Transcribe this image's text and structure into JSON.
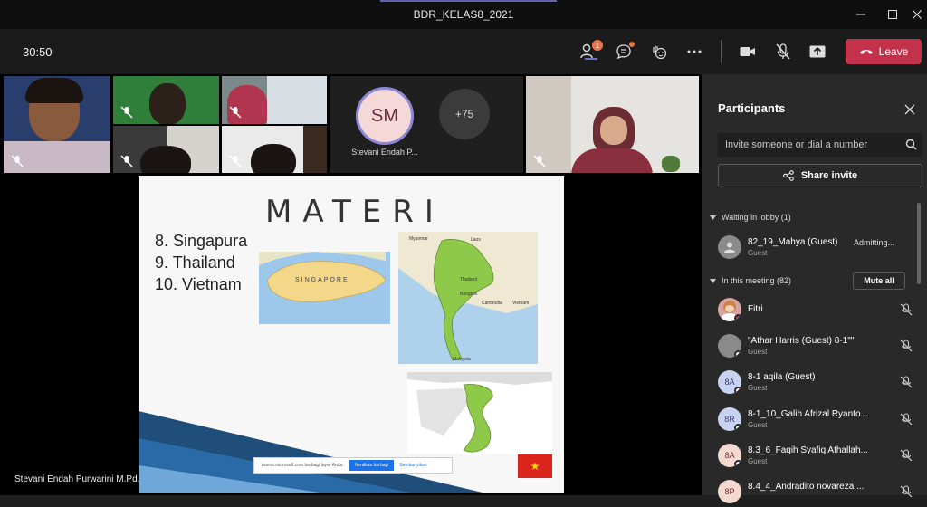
{
  "window": {
    "title": "BDR_KELAS8_2021"
  },
  "toolbar": {
    "timer": "30:50",
    "participants_badge": "1",
    "leave_label": "Leave"
  },
  "gallery": {
    "sm_initials": "SM",
    "sm_name": "Stevani Endah P...",
    "overflow_count": "+75"
  },
  "slide": {
    "title": "MATERI",
    "items": [
      "8. Singapura",
      "9. Thailand",
      "10. Vietnam"
    ],
    "map_label_singapore": "SINGAPORE",
    "map_labels_thailand": [
      "Myanmar",
      "Laos",
      "Thailand",
      "Cambodia",
      "Vietnam",
      "Bangkok",
      "Malaysia"
    ],
    "sharebar_text": "teams.microsoft.com berbagi layar Anda.",
    "sharebar_stop": "Hentikan berbagi",
    "sharebar_hide": "Sembunyikan"
  },
  "presenter_name": "Stevani Endah Purwarini M.Pd.",
  "panel": {
    "title": "Participants",
    "search_placeholder": "Invite someone or dial a number",
    "share_invite": "Share invite",
    "lobby_label": "Waiting in lobby (1)",
    "meeting_label": "In this meeting (82)",
    "mute_all": "Mute all",
    "lobby": [
      {
        "name": "82_19_Mahya (Guest)",
        "sub": "Guest",
        "status": "Admitting..."
      }
    ],
    "members": [
      {
        "name": "Fitri",
        "sub": "",
        "initials": "",
        "color": "#d9a3a3"
      },
      {
        "name": "\"Athar Harris (Guest) 8-1\"\"",
        "sub": "Guest",
        "initials": "",
        "color": "#8a8a8a"
      },
      {
        "name": "8-1 aqila (Guest)",
        "sub": "Guest",
        "initials": "8A",
        "color": "#c7d3f0"
      },
      {
        "name": "8-1_10_Galih Afrizal Ryanto...",
        "sub": "Guest",
        "initials": "8R",
        "color": "#c7d3f0"
      },
      {
        "name": "8.3_6_Faqih Syafiq Athallah...",
        "sub": "Guest",
        "initials": "8A",
        "color": "#f3d9d0"
      },
      {
        "name": "8.4_4_Andradito novareza ...",
        "sub": "",
        "initials": "8P",
        "color": "#f3d9d0"
      }
    ]
  }
}
